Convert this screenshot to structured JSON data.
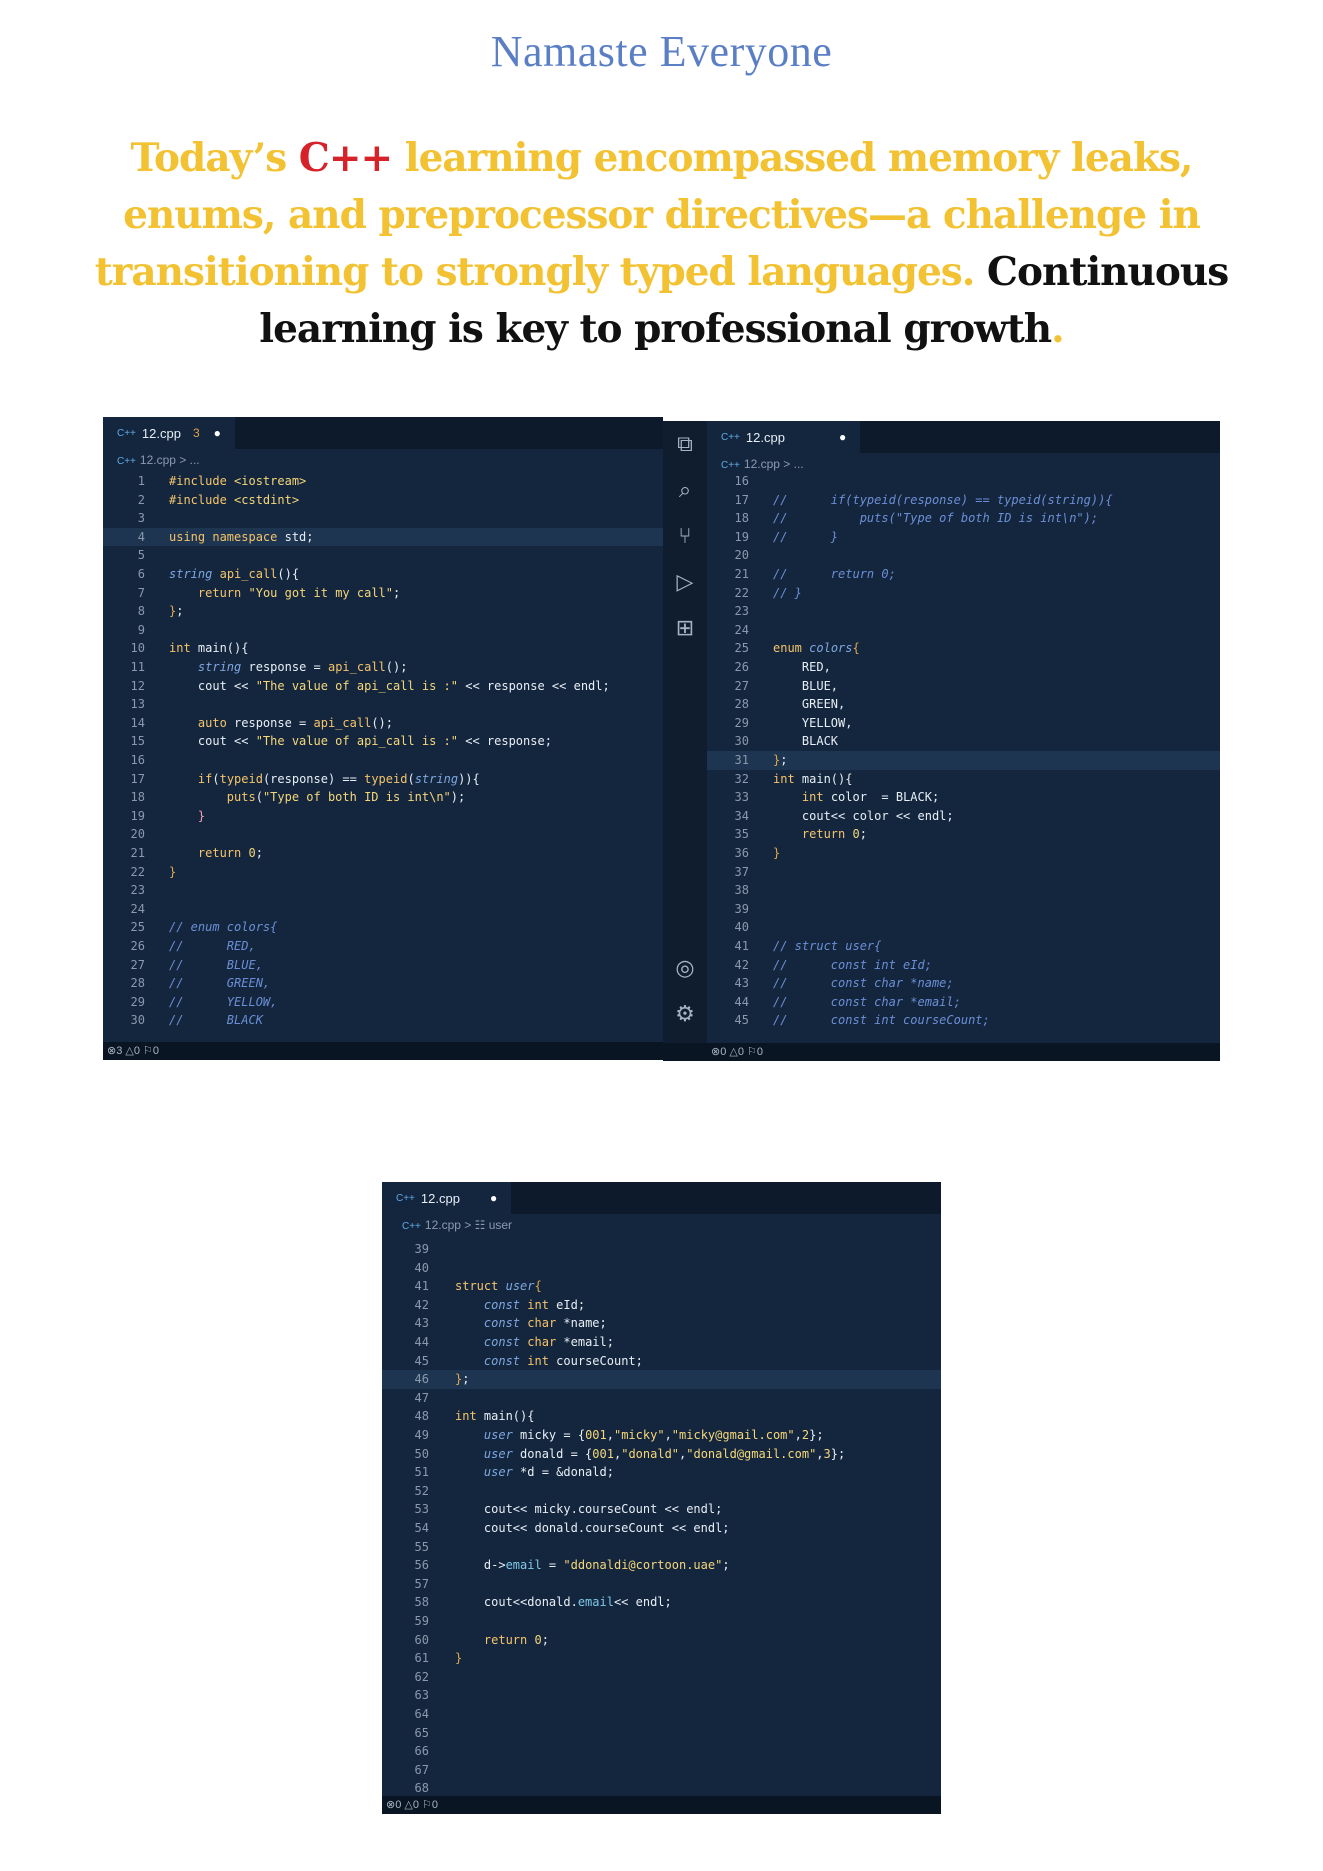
{
  "title": "Namaste Everyone",
  "para": {
    "p1": "Today’s ",
    "p2": "C++",
    "p3": " learning encompassed memory leaks, enums, and preprocessor directives—a challenge in transitioning to strongly typed languages. ",
    "p4": "Continuous learning is key to professional growth",
    "p5": "."
  },
  "editor1": {
    "tab": "12.cpp",
    "badge": "3",
    "crumb": "12.cpp > ...",
    "status": "⊗3 △0   ⚐0",
    "lines": [
      {
        "n": "1",
        "h": "<span class='k'>#include</span> <span class='s'>&lt;iostream&gt;</span>"
      },
      {
        "n": "2",
        "h": "<span class='k'>#include</span> <span class='s'>&lt;cstdint&gt;</span>"
      },
      {
        "n": "3",
        "h": ""
      },
      {
        "n": "4",
        "h": "<span class='k'>using namespace</span> std;",
        "hl": true
      },
      {
        "n": "5",
        "h": ""
      },
      {
        "n": "6",
        "h": "<span class='t'>string</span> <span class='k'>api_call</span>(){"
      },
      {
        "n": "7",
        "h": "    <span class='k'>return</span> <span class='s'>\"You got it my call\"</span>;"
      },
      {
        "n": "8",
        "h": "<span class='p'>}</span>;"
      },
      {
        "n": "9",
        "h": ""
      },
      {
        "n": "10",
        "h": "<span class='k'>int</span> main(){"
      },
      {
        "n": "11",
        "h": "    <span class='t'>string</span> response = <span class='k'>api_call</span>();"
      },
      {
        "n": "12",
        "h": "    cout &lt;&lt; <span class='s'>\"The value of api_call is :\"</span> &lt;&lt; response &lt;&lt; endl;"
      },
      {
        "n": "13",
        "h": ""
      },
      {
        "n": "14",
        "h": "    <span class='k'>auto</span> response = <span class='k'>api_call</span>();"
      },
      {
        "n": "15",
        "h": "    cout &lt;&lt; <span class='s'>\"The value of api_call is :\"</span> &lt;&lt; response;"
      },
      {
        "n": "16",
        "h": ""
      },
      {
        "n": "17",
        "h": "    <span class='k'>if</span>(<span class='k'>typeid</span>(response) == <span class='k'>typeid</span>(<span class='t'>string</span>)){"
      },
      {
        "n": "18",
        "h": "        <span class='k'>puts</span>(<span class='s'>\"Type of both ID is int\\n\"</span>);"
      },
      {
        "n": "19",
        "h": "    <span class='n'>}</span>"
      },
      {
        "n": "20",
        "h": ""
      },
      {
        "n": "21",
        "h": "    <span class='k'>return</span> <span class='s'>0</span>;"
      },
      {
        "n": "22",
        "h": "<span class='p'>}</span>"
      },
      {
        "n": "23",
        "h": ""
      },
      {
        "n": "24",
        "h": ""
      },
      {
        "n": "25",
        "h": "<span class='c'>// enum colors{</span>"
      },
      {
        "n": "26",
        "h": "<span class='c'>//      RED,</span>"
      },
      {
        "n": "27",
        "h": "<span class='c'>//      BLUE,</span>"
      },
      {
        "n": "28",
        "h": "<span class='c'>//      GREEN,</span>"
      },
      {
        "n": "29",
        "h": "<span class='c'>//      YELLOW,</span>"
      },
      {
        "n": "30",
        "h": "<span class='c'>//      BLACK</span>"
      }
    ]
  },
  "editor2": {
    "tab": "12.cpp",
    "crumb": "12.cpp > ...",
    "status": "⊗0 △0   ⚐0",
    "lines": [
      {
        "n": "16",
        "h": ""
      },
      {
        "n": "17",
        "h": "<span class='c'>//      if(typeid(response) == typeid(string)){</span>"
      },
      {
        "n": "18",
        "h": "<span class='c'>//          puts(\"Type of both ID is int\\n\");</span>"
      },
      {
        "n": "19",
        "h": "<span class='c'>//      }</span>"
      },
      {
        "n": "20",
        "h": ""
      },
      {
        "n": "21",
        "h": "<span class='c'>//      return 0;</span>"
      },
      {
        "n": "22",
        "h": "<span class='c'>// }</span>"
      },
      {
        "n": "23",
        "h": ""
      },
      {
        "n": "24",
        "h": ""
      },
      {
        "n": "25",
        "h": "<span class='k'>enum</span> <span class='t'>colors</span><span class='p'>{</span>"
      },
      {
        "n": "26",
        "h": "    RED,"
      },
      {
        "n": "27",
        "h": "    BLUE,"
      },
      {
        "n": "28",
        "h": "    GREEN,"
      },
      {
        "n": "29",
        "h": "    YELLOW,"
      },
      {
        "n": "30",
        "h": "    BLACK"
      },
      {
        "n": "31",
        "h": "<span class='p'>}</span>;",
        "hl": true
      },
      {
        "n": "32",
        "h": "<span class='k'>int</span> main(){"
      },
      {
        "n": "33",
        "h": "    <span class='k'>int</span> color  = BLACK;"
      },
      {
        "n": "34",
        "h": "    cout&lt;&lt; color &lt;&lt; endl;"
      },
      {
        "n": "35",
        "h": "    <span class='k'>return</span> <span class='s'>0</span>;"
      },
      {
        "n": "36",
        "h": "<span class='p'>}</span>"
      },
      {
        "n": "37",
        "h": ""
      },
      {
        "n": "38",
        "h": ""
      },
      {
        "n": "39",
        "h": ""
      },
      {
        "n": "40",
        "h": ""
      },
      {
        "n": "41",
        "h": "<span class='c'>// struct user{</span>"
      },
      {
        "n": "42",
        "h": "<span class='c'>//      const int eId;</span>"
      },
      {
        "n": "43",
        "h": "<span class='c'>//      const char *name;</span>"
      },
      {
        "n": "44",
        "h": "<span class='c'>//      const char *email;</span>"
      },
      {
        "n": "45",
        "h": "<span class='c'>//      const int courseCount;</span>"
      }
    ]
  },
  "editor3": {
    "tab": "12.cpp",
    "crumb": "12.cpp > ☷ user",
    "status": "⊗0 △0   ⚐0",
    "lines": [
      {
        "n": "39",
        "h": ""
      },
      {
        "n": "40",
        "h": ""
      },
      {
        "n": "41",
        "h": "<span class='k'>struct</span> <span class='t'>user</span><span class='p'>{</span>"
      },
      {
        "n": "42",
        "h": "    <span class='t'>const</span> <span class='k'>int</span> eId;"
      },
      {
        "n": "43",
        "h": "    <span class='t'>const</span> <span class='k'>char</span> *name;"
      },
      {
        "n": "44",
        "h": "    <span class='t'>const</span> <span class='k'>char</span> *email;"
      },
      {
        "n": "45",
        "h": "    <span class='t'>const</span> <span class='k'>int</span> courseCount;"
      },
      {
        "n": "46",
        "h": "<span class='p'>}</span>;",
        "hl": true
      },
      {
        "n": "47",
        "h": ""
      },
      {
        "n": "48",
        "h": "<span class='k'>int</span> main(){"
      },
      {
        "n": "49",
        "h": "    <span class='t'>user</span> micky = {<span class='s'>001</span>,<span class='s'>\"micky\"</span>,<span class='s'>\"micky@gmail.com\"</span>,<span class='s'>2</span>};"
      },
      {
        "n": "50",
        "h": "    <span class='t'>user</span> donald = {<span class='s'>001</span>,<span class='s'>\"donald\"</span>,<span class='s'>\"donald@gmail.com\"</span>,<span class='s'>3</span>};"
      },
      {
        "n": "51",
        "h": "    <span class='t'>user</span> *d = &amp;donald;"
      },
      {
        "n": "52",
        "h": ""
      },
      {
        "n": "53",
        "h": "    cout&lt;&lt; micky.courseCount &lt;&lt; endl;"
      },
      {
        "n": "54",
        "h": "    cout&lt;&lt; donald.courseCount &lt;&lt; endl;"
      },
      {
        "n": "55",
        "h": ""
      },
      {
        "n": "56",
        "h": "    d-&gt;<span class='m'>email</span> = <span class='s'>\"ddonaldi@cortoon.uae\"</span>;"
      },
      {
        "n": "57",
        "h": ""
      },
      {
        "n": "58",
        "h": "    cout&lt;&lt;donald.<span class='m'>email</span>&lt;&lt; endl;"
      },
      {
        "n": "59",
        "h": ""
      },
      {
        "n": "60",
        "h": "    <span class='k'>return</span> <span class='s'>0</span>;"
      },
      {
        "n": "61",
        "h": "<span class='p'>}</span>"
      },
      {
        "n": "62",
        "h": ""
      },
      {
        "n": "63",
        "h": ""
      },
      {
        "n": "64",
        "h": ""
      },
      {
        "n": "65",
        "h": ""
      },
      {
        "n": "66",
        "h": ""
      },
      {
        "n": "67",
        "h": ""
      },
      {
        "n": "68",
        "h": ""
      }
    ]
  },
  "colors": {
    "gold": "#f2c233",
    "red": "#d6232a",
    "editor_bg": "#14263d",
    "title_blue": "#5b7fc4"
  },
  "icons": [
    "explorer-icon",
    "search-icon",
    "source-control-icon",
    "run-debug-icon",
    "extensions-icon",
    "account-icon",
    "settings-gear-icon"
  ]
}
